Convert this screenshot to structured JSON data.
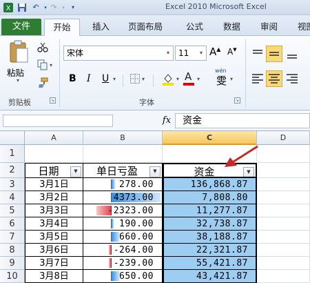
{
  "app": {
    "title": "Excel 2010 Microsoft Excel"
  },
  "tabs": {
    "file": "文件",
    "home": "开始",
    "insert": "插入",
    "page_layout": "页面布局",
    "formulas": "公式",
    "data": "数据",
    "review": "审阅",
    "view": "视图"
  },
  "ribbon": {
    "clipboard": {
      "paste": "粘贴",
      "group_label": "剪贴板"
    },
    "font": {
      "name": "宋体",
      "size": "11",
      "bold": "B",
      "italic": "I",
      "underline": "U",
      "group_label": "字体",
      "grow": "A",
      "shrink": "A",
      "color": "A",
      "phonetic": "wén",
      "phonetic_char": "雯"
    }
  },
  "formula_bar": {
    "fx": "fx",
    "value": "资金"
  },
  "columns": [
    "A",
    "B",
    "C",
    "D"
  ],
  "rows": [
    "1",
    "2",
    "3",
    "4",
    "5",
    "6",
    "7",
    "8",
    "9",
    "10"
  ],
  "table": {
    "headers": [
      "日期",
      "单日亏盈",
      "资金"
    ],
    "data": [
      {
        "date": "3月1日",
        "pnl": "278.00",
        "funds": "136,868.87"
      },
      {
        "date": "3月2日",
        "pnl": "4373.00",
        "funds": "7,808.80"
      },
      {
        "date": "3月3日",
        "pnl": "-2323.00",
        "funds": "11,277.87"
      },
      {
        "date": "3月4日",
        "pnl": "190.00",
        "funds": "32,738.87"
      },
      {
        "date": "3月5日",
        "pnl": "660.00",
        "funds": "38,188.87"
      },
      {
        "date": "3月6日",
        "pnl": "-264.00",
        "funds": "22,321.87"
      },
      {
        "date": "3月7日",
        "pnl": "-239.00",
        "funds": "55,421.87"
      },
      {
        "date": "3月8日",
        "pnl": "650.00",
        "funds": "43,421.87"
      }
    ]
  },
  "colors": {
    "file_tab": "#2e7d32",
    "selection_fill": "#9ecdf2",
    "databar_positive": "#3b8fe0",
    "databar_negative": "#e0464b",
    "arrow": "#c62828"
  }
}
